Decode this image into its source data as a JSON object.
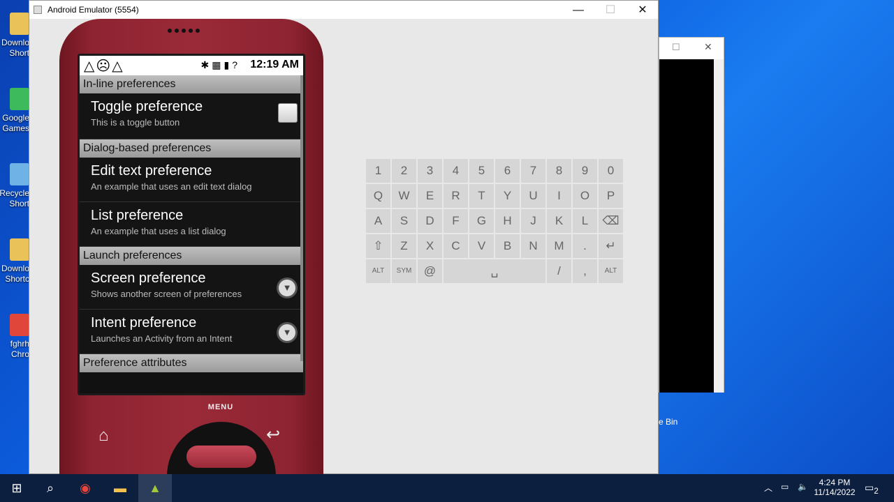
{
  "desktop": {
    "icons": [
      {
        "line1": "Downlo",
        "line2": "Short",
        "color": "#e9c25a"
      },
      {
        "line1": "Google",
        "line2": "Games",
        "color": "#3dba5c"
      },
      {
        "line1": "Recycle",
        "line2": "Short",
        "color": "#6fb3e6"
      },
      {
        "line1": "Downlo",
        "line2": "Shortc",
        "color": "#e9c25a"
      },
      {
        "line1": "fghrh",
        "line2": "Chro",
        "color": "#e0463a"
      }
    ],
    "bin_label": "e Bin"
  },
  "window": {
    "title": "Android Emulator (5554)",
    "minimize": "—",
    "maximize": "☐",
    "close": "✕"
  },
  "phone": {
    "status": {
      "left_icons": "△☹△",
      "right_icons": "✱▦▮?",
      "time": "12:19 AM"
    },
    "sections": [
      {
        "header": "In-line preferences",
        "items": [
          {
            "title": "Toggle preference",
            "summary": "This is a toggle button",
            "widget": "checkbox"
          }
        ]
      },
      {
        "header": "Dialog-based preferences",
        "items": [
          {
            "title": "Edit text preference",
            "summary": "An example that uses an edit text dialog"
          },
          {
            "title": "List preference",
            "summary": "An example that uses a list dialog"
          }
        ]
      },
      {
        "header": "Launch preferences",
        "items": [
          {
            "title": "Screen preference",
            "summary": "Shows another screen of preferences",
            "widget": "arrow"
          },
          {
            "title": "Intent preference",
            "summary": "Launches an Activity from an Intent",
            "widget": "arrow"
          }
        ]
      },
      {
        "header": "Preference attributes"
      }
    ],
    "menu_label": "MENU",
    "home_icon": "⌂",
    "back_icon": "↩"
  },
  "keyboard": {
    "rows": [
      [
        "1",
        "2",
        "3",
        "4",
        "5",
        "6",
        "7",
        "8",
        "9",
        "0"
      ],
      [
        "Q",
        "W",
        "E",
        "R",
        "T",
        "Y",
        "U",
        "I",
        "O",
        "P"
      ],
      [
        "A",
        "S",
        "D",
        "F",
        "G",
        "H",
        "J",
        "K",
        "L",
        "⌫"
      ],
      [
        "⇧",
        "Z",
        "X",
        "C",
        "V",
        "B",
        "N",
        "M",
        ".",
        "↵"
      ]
    ],
    "shift_row0": [
      "!",
      "\"",
      "#",
      "$",
      "%",
      "^",
      "&",
      "*",
      "(",
      ")"
    ],
    "bottom": {
      "alt_left": "ALT",
      "sym": "SYM",
      "at": "@",
      "space": "␣",
      "slash": "/",
      "comma": ",",
      "alt_right": "ALT"
    }
  },
  "taskbar": {
    "time": "4:24 PM",
    "date": "11/14/2022",
    "notif": "2"
  }
}
